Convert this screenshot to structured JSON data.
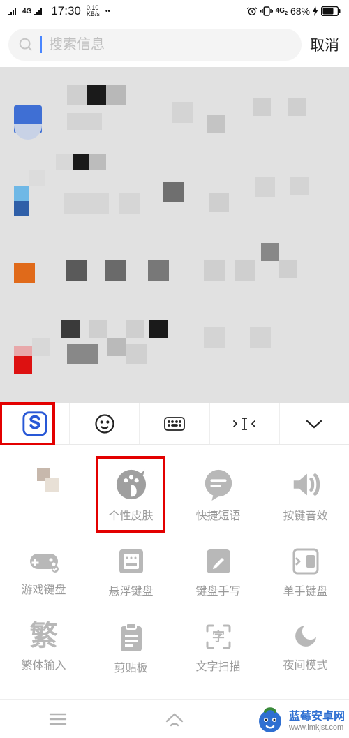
{
  "status": {
    "signal_label": "4G",
    "time": "17:30",
    "net_speed": "0.10",
    "net_unit": "KB/s",
    "battery_pct": "68%"
  },
  "search": {
    "placeholder": "搜索信息",
    "value": ""
  },
  "cancel_label": "取消",
  "ime_toolbar": {
    "logo": "sogou-logo",
    "items": [
      "emoji",
      "keyboard-switch",
      "cursor-move",
      "collapse"
    ]
  },
  "ime_grid": [
    [
      {
        "icon": "blur",
        "label": ""
      },
      {
        "icon": "palette",
        "label": "个性皮肤"
      },
      {
        "icon": "chat",
        "label": "快捷短语"
      },
      {
        "icon": "sound",
        "label": "按键音效"
      }
    ],
    [
      {
        "icon": "gamepad",
        "label": "游戏键盘"
      },
      {
        "icon": "float-kb",
        "label": "悬浮键盘"
      },
      {
        "icon": "pen-kb",
        "label": "键盘手写"
      },
      {
        "icon": "onehand",
        "label": "单手键盘"
      }
    ],
    [
      {
        "icon": "fan",
        "label": "繁体输入"
      },
      {
        "icon": "clipboard",
        "label": "剪贴板"
      },
      {
        "icon": "scan",
        "label": "文字扫描"
      },
      {
        "icon": "moon",
        "label": "夜间模式"
      }
    ]
  ],
  "watermark": {
    "title": "蓝莓安卓网",
    "url": "www.lmkjst.com"
  }
}
